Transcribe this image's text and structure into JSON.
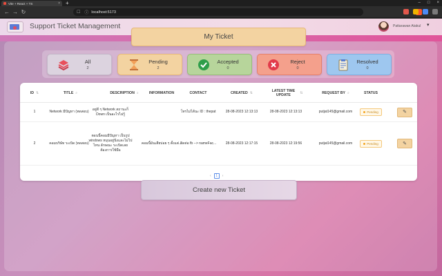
{
  "browser": {
    "tab_title": "Vite + React + TS",
    "tab_close": "×",
    "new_tab": "+",
    "url": "localhost:5173",
    "window_controls": [
      "–",
      "□",
      "×"
    ]
  },
  "header": {
    "title": "Support Ticket Management",
    "user_name": "Pattarawan Atakul",
    "caret": "▾"
  },
  "my_ticket": {
    "label": "My Ticket"
  },
  "stats": [
    {
      "key": "all",
      "label": "All",
      "count": "2",
      "bg": "#dcd3df",
      "border": "#c5b8c9",
      "icon": "stack-icon"
    },
    {
      "key": "pending",
      "label": "Pending",
      "count": "2",
      "bg": "#f3d3a1",
      "border": "#e8b97a",
      "icon": "hourglass-icon"
    },
    {
      "key": "accepted",
      "label": "Accepted",
      "count": "0",
      "bg": "#b7d59b",
      "border": "#98bd79",
      "icon": "check-circle-icon"
    },
    {
      "key": "reject",
      "label": "Reject",
      "count": "0",
      "bg": "#f4a08c",
      "border": "#e5806a",
      "icon": "x-circle-icon"
    },
    {
      "key": "resolved",
      "label": "Resolved",
      "count": "0",
      "bg": "#9ec7ef",
      "border": "#7fb0e2",
      "icon": "clipboard-icon"
    }
  ],
  "table": {
    "columns": [
      {
        "key": "id",
        "label": "ID",
        "icon": "sort-icon"
      },
      {
        "key": "title",
        "label": "TITLE",
        "icon": "search-icon"
      },
      {
        "key": "description",
        "label": "DESCRIPTION",
        "icon": "search-icon"
      },
      {
        "key": "information",
        "label": "INFORMATION",
        "icon": ""
      },
      {
        "key": "contact",
        "label": "CONTACT",
        "icon": ""
      },
      {
        "key": "created",
        "label": "CREATED",
        "icon": "sort-icon"
      },
      {
        "key": "latest",
        "label": "LATEST TIME UPDATE",
        "icon": "sort-icon"
      },
      {
        "key": "request_by",
        "label": "REQUEST BY",
        "icon": "search-icon"
      },
      {
        "key": "status",
        "label": "STATUS",
        "icon": ""
      }
    ],
    "rows": [
      {
        "id": "1",
        "title": "Network มีปัญหา (ทดสอบ)",
        "description": "อยู่ดี ๆ Network สถานะก็ Down เป็นอะไรไม่รู้",
        "information": "",
        "contact": "โทรไม่ได้นะ ID : thepat",
        "created": "28-08-2023 12:13:13",
        "latest": "28-08-2023 12:13:13",
        "request_by": "putjat145@gmail.com",
        "status": "Pending"
      },
      {
        "id": "2",
        "title": "คอมบริษัท ระเบิด (ทดสอบ)",
        "description": "ตอนนี้คอมมีปัญหา เป็นรูป windows หมุนอยู่นิ่งและไม่ไปไหน ลักษณะ ระเบิดเลย ต้องการใช้มือ",
        "information": "คอมนี้มันเสียบ่อย ๆ ตั้งแต่...",
        "contact": "ติดต่อ fb --> nameFac...",
        "created": "28-08-2023 12:17:15",
        "latest": "28-08-2023 12:19:56",
        "request_by": "putjat145@gmail.com",
        "status": "Pending"
      }
    ],
    "pager": {
      "prev": "‹",
      "page": "1",
      "next": "›"
    }
  },
  "create_button": {
    "label": "Create new Ticket"
  },
  "colors": {
    "accent_pink": "#e0559a",
    "pending": "#f5a623"
  }
}
